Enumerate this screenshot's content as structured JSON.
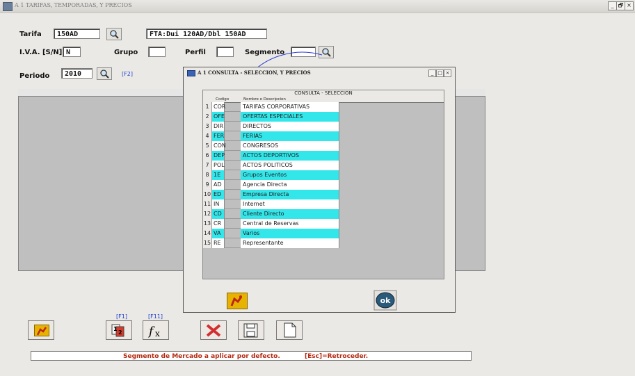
{
  "window": {
    "title": "A 1  TARIFAS, TEMPORADAS, Y PRECIOS",
    "min": "_",
    "max": "🗗",
    "close": "×"
  },
  "form": {
    "tarifa_label": "Tarifa",
    "tarifa_value": "150AD",
    "tarifa_desc": "FTA:Dui 120AD/Dbl 150AD",
    "iva_label": "I.V.A. [S/N]",
    "iva_value": "N",
    "grupo_label": "Grupo",
    "grupo_value": "",
    "perfil_label": "Perfil",
    "perfil_value": "",
    "segmento_label": "Segmento",
    "segmento_value": "",
    "periodo_label": "Periodo",
    "periodo_value": "2010",
    "periodo_key": "[F2]"
  },
  "dialog": {
    "title": "A 1 CONSULTA - SELECCION, Y PRECIOS",
    "table_caption": "CONSULTA - SELECCION",
    "col_code": "Codigo",
    "col_desc": "Nombre o Descripcion",
    "rows": [
      {
        "n": "1",
        "code": "COR",
        "desc": "TARIFAS CORPORATIVAS",
        "hl": false
      },
      {
        "n": "2",
        "code": "OFE",
        "desc": "OFERTAS ESPECIALES",
        "hl": true
      },
      {
        "n": "3",
        "code": "DIR",
        "desc": "DIRECTOS",
        "hl": false
      },
      {
        "n": "4",
        "code": "FER",
        "desc": "FERIAS",
        "hl": true
      },
      {
        "n": "5",
        "code": "CON",
        "desc": "CONGRESOS",
        "hl": false
      },
      {
        "n": "6",
        "code": "DEP",
        "desc": "ACTOS DEPORTIVOS",
        "hl": true
      },
      {
        "n": "7",
        "code": "POL",
        "desc": "ACTOS POLITICOS",
        "hl": false
      },
      {
        "n": "8",
        "code": "1E",
        "desc": "Grupos Eventos",
        "hl": true
      },
      {
        "n": "9",
        "code": "AD",
        "desc": "Agencia Directa",
        "hl": false
      },
      {
        "n": "10",
        "code": "ED",
        "desc": "Empresa Directa",
        "hl": true
      },
      {
        "n": "11",
        "code": "IN",
        "desc": "Internet",
        "hl": false
      },
      {
        "n": "12",
        "code": "CD",
        "desc": "Cliente Directo",
        "hl": true
      },
      {
        "n": "13",
        "code": "CR",
        "desc": "Central de Reservas",
        "hl": false
      },
      {
        "n": "14",
        "code": "VA",
        "desc": "Varios",
        "hl": true
      },
      {
        "n": "15",
        "code": "RE",
        "desc": "Representante",
        "hl": false
      }
    ],
    "ok_label": "ok"
  },
  "toolbar": {
    "f1": "[F1]",
    "f11": "[F11]"
  },
  "status": {
    "text": "Segmento de Mercado a aplicar  por defecto.",
    "esc": "[Esc]=Retroceder."
  },
  "colors": {
    "highlight": "#33e6ea",
    "accent": "#1f3fd0",
    "status_text": "#b52a12"
  }
}
